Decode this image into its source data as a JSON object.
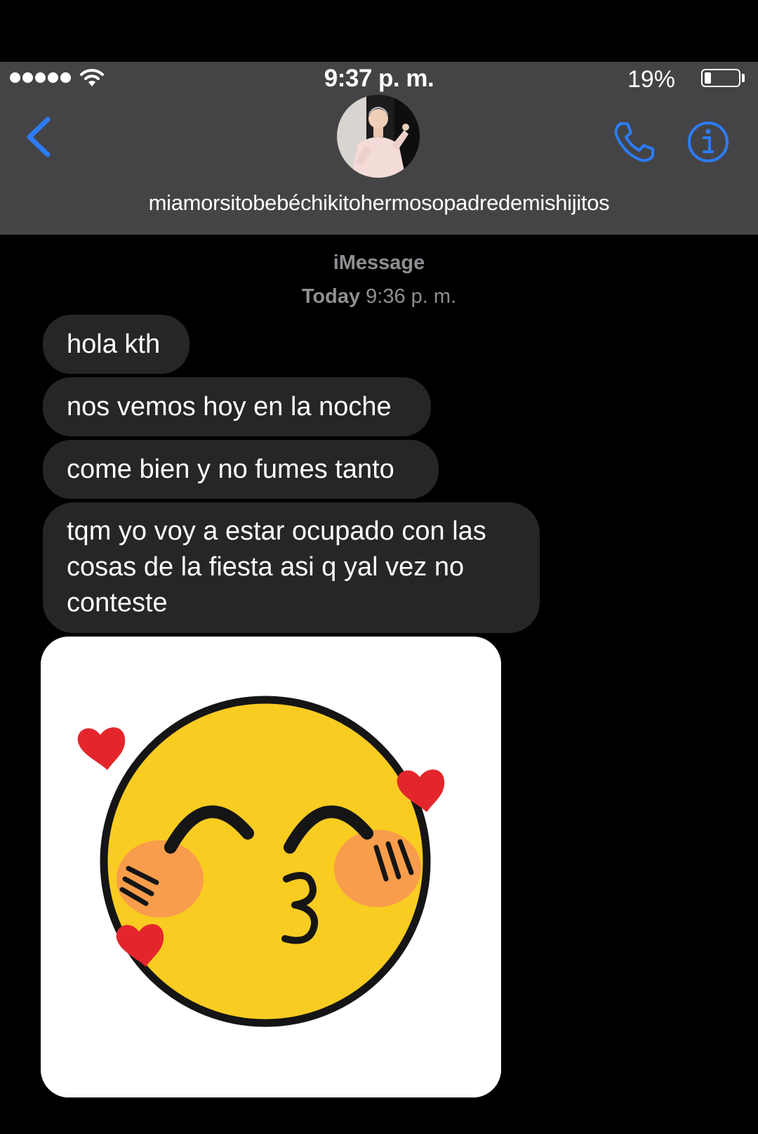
{
  "status_bar": {
    "time": "9:37 p. m.",
    "battery_percent": "19%",
    "battery_level": 0.19,
    "signal_bars": 5
  },
  "header": {
    "contact_name": "miamorsitobebéchikitohermosopadredemishijitos",
    "back_icon": "chevron-left-icon",
    "call_icon": "phone-icon",
    "info_icon": "info-icon"
  },
  "conversation": {
    "service": "iMessage",
    "date_day": "Today",
    "date_time": "9:36 p. m.",
    "messages": [
      {
        "text": "hola kth"
      },
      {
        "text": "nos vemos hoy en la noche"
      },
      {
        "text": "come bien y no fumes tanto"
      },
      {
        "text": "tqm yo voy a estar ocupado con las cosas de la fiesta asi q yal vez no conteste"
      }
    ],
    "image_message": {
      "content": "kissing-face-emoji-with-hearts"
    }
  },
  "colors": {
    "accent": "#2d7cf6",
    "header_bg": "#444446",
    "bubble_bg": "#262628",
    "secondary_text": "#8e8e93",
    "emoji_yellow": "#f9cc22",
    "blush": "#f89a4e",
    "heart": "#e3262c"
  }
}
